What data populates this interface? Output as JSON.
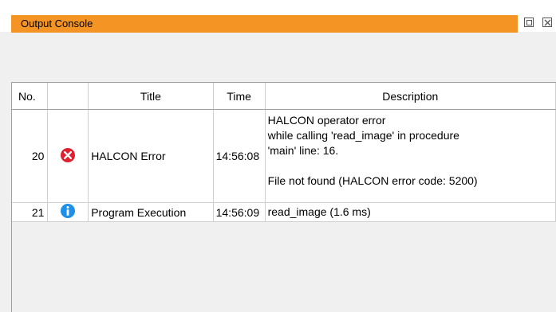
{
  "window": {
    "title": "Output Console"
  },
  "toolbar": {
    "icons": [
      "broom-icon",
      "save-icon",
      "copy-icon",
      "gear-icon"
    ]
  },
  "table": {
    "headers": {
      "no": "No.",
      "icon": "",
      "title": "Title",
      "time": "Time",
      "description": "Description"
    },
    "rows": [
      {
        "no": "20",
        "status": "error",
        "title": "HALCON Error",
        "time": "14:56:08",
        "description": [
          "HALCON operator error",
          "while calling 'read_image' in procedure",
          "'main' line: 16.",
          "",
          "File not found (HALCON error code: 5200)"
        ]
      },
      {
        "no": "21",
        "status": "info",
        "title": "Program Execution",
        "time": "14:56:09",
        "description": [
          "read_image (1.6 ms)"
        ]
      }
    ]
  },
  "colors": {
    "title_bar": "#f39424",
    "error_icon": "#e0202e",
    "info_icon": "#1e90ea"
  }
}
